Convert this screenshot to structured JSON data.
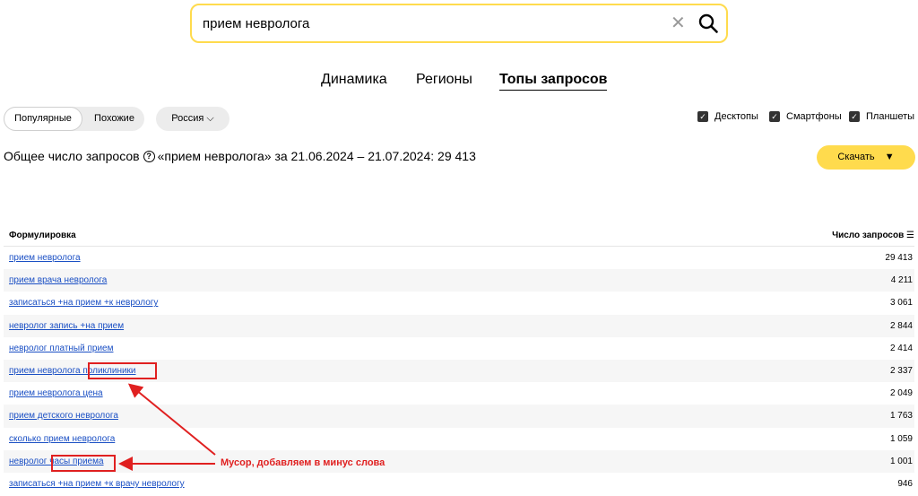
{
  "search": {
    "value": "прием невролога"
  },
  "tabs": [
    {
      "label": "Динамика"
    },
    {
      "label": "Регионы"
    },
    {
      "label": "Топы запросов"
    }
  ],
  "filters": {
    "popular": "Популярные",
    "similar": "Похожие",
    "region": "Россия",
    "devices": [
      "Десктопы",
      "Смартфоны",
      "Планшеты"
    ]
  },
  "summary": {
    "prefix": "Общее число запросов",
    "rest": "«прием невролога» за 21.06.2024 – 21.07.2024: 29 413"
  },
  "download": {
    "label": "Скачать"
  },
  "table": {
    "col_query": "Формулировка",
    "col_count": "Число запросов",
    "rows": [
      {
        "q": "прием невролога",
        "n": "29 413"
      },
      {
        "q": "прием врача невролога",
        "n": "4 211"
      },
      {
        "q": "записаться +на прием +к неврологу",
        "n": "3 061"
      },
      {
        "q": "невролог запись +на прием",
        "n": "2 844"
      },
      {
        "q": "невролог платный прием",
        "n": "2 414"
      },
      {
        "q": "прием невролога поликлиники",
        "n": "2 337"
      },
      {
        "q": "прием невролога цена",
        "n": "2 049"
      },
      {
        "q": "прием детского невролога",
        "n": "1 763"
      },
      {
        "q": "сколько прием невролога",
        "n": "1 059"
      },
      {
        "q": "невролог часы приема",
        "n": "1 001"
      },
      {
        "q": "записаться +на прием +к врачу неврологу",
        "n": "946"
      }
    ]
  },
  "annotation": {
    "text": "Мусор, добавляем в минус слова",
    "color": "#e02020"
  },
  "colors": {
    "accent": "#ffdb4d",
    "link": "#1a4fc4"
  }
}
